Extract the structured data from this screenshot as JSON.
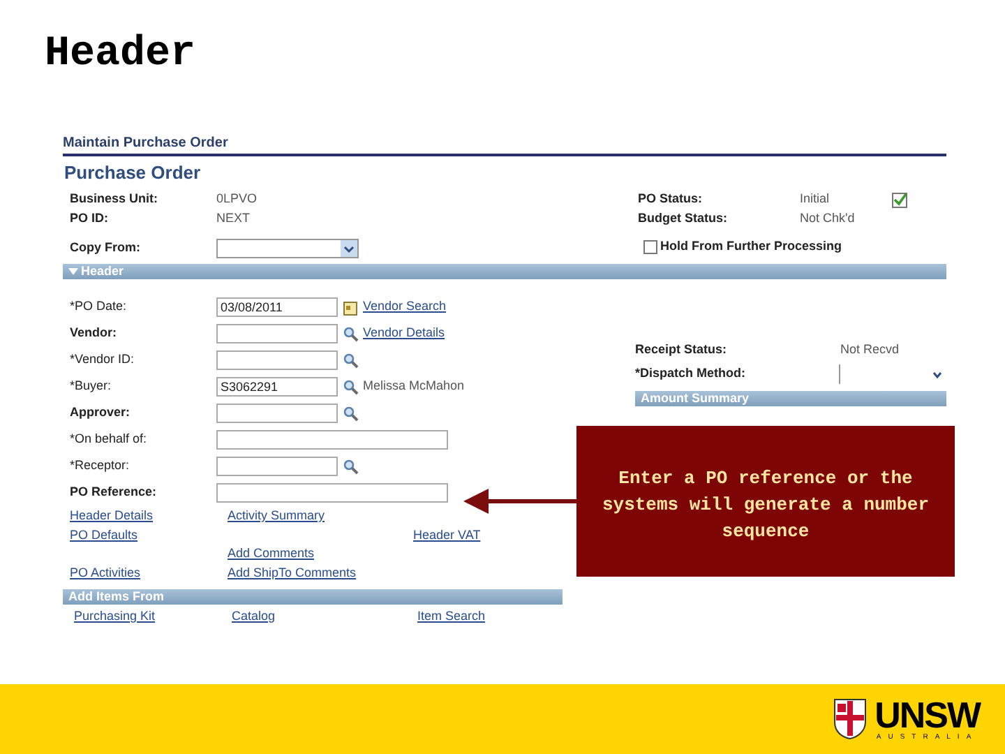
{
  "slide_title": "Header",
  "page": {
    "breadcrumb": "Maintain Purchase Order",
    "title": "Purchase Order"
  },
  "info_left": [
    {
      "label": "Business Unit:",
      "value": "0LPVO"
    },
    {
      "label": "PO ID:",
      "value": "NEXT"
    }
  ],
  "info_right": [
    {
      "label": "PO Status:",
      "value": "Initial"
    },
    {
      "label": "Budget Status:",
      "value": "Not Chk'd"
    }
  ],
  "copy_from": {
    "label": "Copy From:"
  },
  "hold": {
    "label": "Hold From Further Processing",
    "checked": false
  },
  "header_section": {
    "title": "Header",
    "expanded": true
  },
  "fields": [
    {
      "kind": "date",
      "label": "*PO Date:",
      "value": "03/08/2011",
      "link": "Vendor Search"
    },
    {
      "kind": "lookup",
      "label": "Vendor:",
      "link": "Vendor Details"
    },
    {
      "kind": "lookup",
      "label": "*Vendor ID:"
    },
    {
      "kind": "lookup",
      "label": "*Buyer:",
      "value": "S3062291",
      "note": "Melissa McMahon"
    },
    {
      "kind": "lookup",
      "label": "Approver:"
    },
    {
      "kind": "text",
      "label": "*On behalf of:"
    },
    {
      "kind": "lookup",
      "label": "*Receptor:"
    },
    {
      "kind": "text",
      "label": "PO Reference:"
    }
  ],
  "receipt_status": {
    "label": "Receipt Status:",
    "value": "Not Recvd"
  },
  "dispatch": {
    "label": "*Dispatch Method:"
  },
  "amount_summary": {
    "title": "Amount Summary"
  },
  "links": [
    {
      "column_1": "Header Details",
      "column_2": "Activity Summary"
    },
    {
      "column_1": "PO Defaults",
      "column_3": "Header VAT"
    },
    {
      "column_2": "Add Comments"
    },
    {
      "column_1": "PO Activities",
      "column_2": "Add ShipTo Comments"
    }
  ],
  "add_items": {
    "title": "Add Items From",
    "items": [
      "Purchasing Kit",
      "Catalog",
      "Item Search"
    ]
  },
  "callout": {
    "text": "Enter a PO reference or the systems will generate a number sequence"
  },
  "footer": {
    "logo_text": "UNSW",
    "logo_subtext": "AUSTRALIA"
  }
}
